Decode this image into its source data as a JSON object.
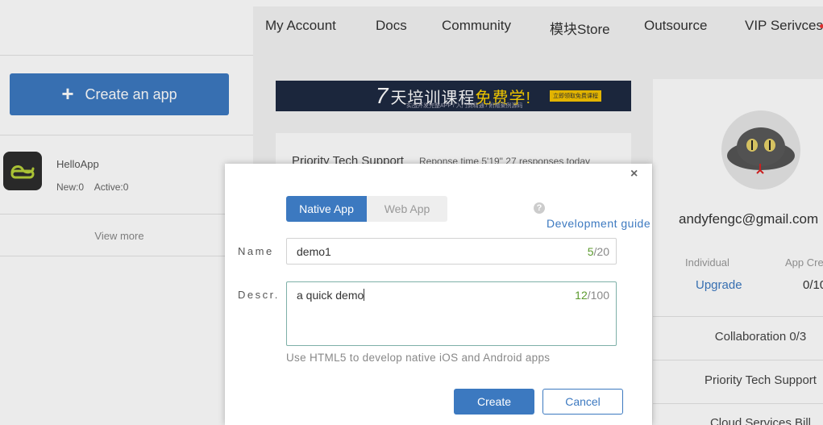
{
  "nav": {
    "items": [
      "My Account",
      "Docs",
      "Community",
      "模块Store",
      "Outsource",
      "VIP Serivces"
    ]
  },
  "left": {
    "create_app_label": "Create an app",
    "apps": [
      {
        "name": "HelloApp",
        "new_label": "New:0",
        "active_label": "Active:0"
      }
    ],
    "view_more": "View more"
  },
  "banner": {
    "seven": "7",
    "headline_a": "天培训课程",
    "headline_free": "免费学!",
    "subtext": "实战开发完整APP / 入门到精通 / 附赠案例源码",
    "cta": "立即领取免费课程"
  },
  "support": {
    "title": "Priority Tech Support",
    "response": "Reponse time 5'19\"  27  responses today"
  },
  "profile": {
    "email": "andyfengc@gmail.com",
    "plan_label": "Individual",
    "app_created_label": "App Cre",
    "upgrade": "Upgrade",
    "app_count": "0/10",
    "rows": [
      "Collaboration 0/3",
      "Priority Tech Support",
      "Cloud Services Bill"
    ]
  },
  "modal": {
    "close": "×",
    "tabs": {
      "native": "Native App",
      "web": "Web App"
    },
    "help": "?",
    "dev_guide": "Development guide",
    "name_label": "Name",
    "name_value": "demo1",
    "name_count": "5",
    "name_max": "/20",
    "descr_label": "Descr.",
    "descr_value": "a quick demo",
    "descr_count": "12",
    "descr_max": "/100",
    "hint": "Use HTML5 to develop native iOS and Android apps",
    "create": "Create",
    "cancel": "Cancel"
  },
  "colors": {
    "accent": "#3c79c0",
    "counter_green": "#5c9a2e"
  }
}
